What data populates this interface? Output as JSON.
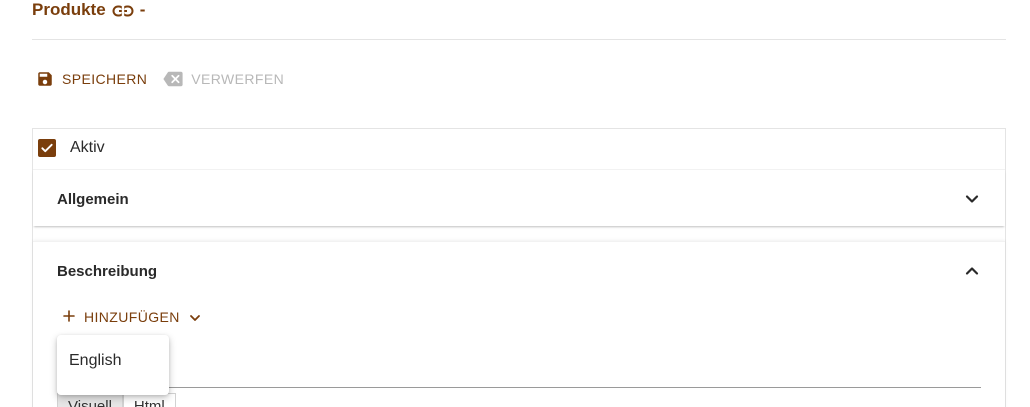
{
  "header": {
    "title": "Produkte",
    "title_icon": "link-icon",
    "title_suffix": "-"
  },
  "toolbar": {
    "save_label": "SPEICHERN",
    "save_icon": "save-icon",
    "discard_label": "VERWERFEN",
    "discard_icon": "backspace-icon",
    "discard_enabled": false
  },
  "form": {
    "active_label": "Aktiv",
    "active_checked": true,
    "sections": {
      "general": {
        "title": "Allgemein",
        "expanded": false
      },
      "description": {
        "title": "Beschreibung",
        "expanded": true,
        "add_label": "HINZUFÜGEN",
        "language_menu": [
          "English"
        ],
        "editor_tabs": [
          "Visuell",
          "Html"
        ],
        "active_editor_tab": "Visuell"
      }
    }
  },
  "colors": {
    "accent": "#7a3e0c",
    "disabled": "#b8b8b8",
    "border": "#e4e4e4"
  }
}
